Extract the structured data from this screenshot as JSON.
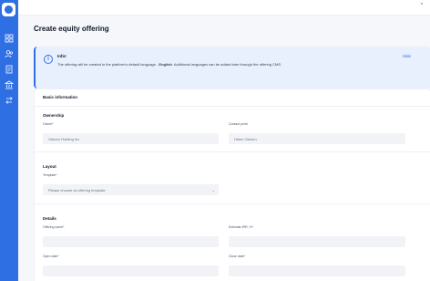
{
  "nav": {
    "icons": [
      "dashboard-icon",
      "users-icon",
      "document-icon",
      "bank-icon",
      "swap-icon"
    ]
  },
  "page": {
    "title": "Create equity offering"
  },
  "info": {
    "title": "Info!",
    "text_before": "The offering will be created in the platform's default language - ",
    "language": "English",
    "text_after": ". Additional languages can be added later through the offering CMS.",
    "hide": "Hide"
  },
  "form": {
    "card_title": "Basic information",
    "ownership": {
      "title": "Ownership",
      "owner_label": "Owner*",
      "owner_value": "Osborn Holding Inc",
      "contact_label": "Contact point",
      "contact_value": "Helen Osborn"
    },
    "layout": {
      "title": "Layout",
      "template_label": "Template*",
      "template_placeholder": "Please choose an offering template"
    },
    "details": {
      "title": "Details",
      "offering_name_label": "Offering name*",
      "irr_label": "Estimate IRR, %*",
      "open_date_label": "Open date*",
      "close_date_label": "Close date*"
    }
  },
  "colors": {
    "accent": "#2f6fe4",
    "info_bg": "#e8f0fd",
    "page_bg": "#f5f7fb",
    "field_bg": "#f1f3f7"
  }
}
